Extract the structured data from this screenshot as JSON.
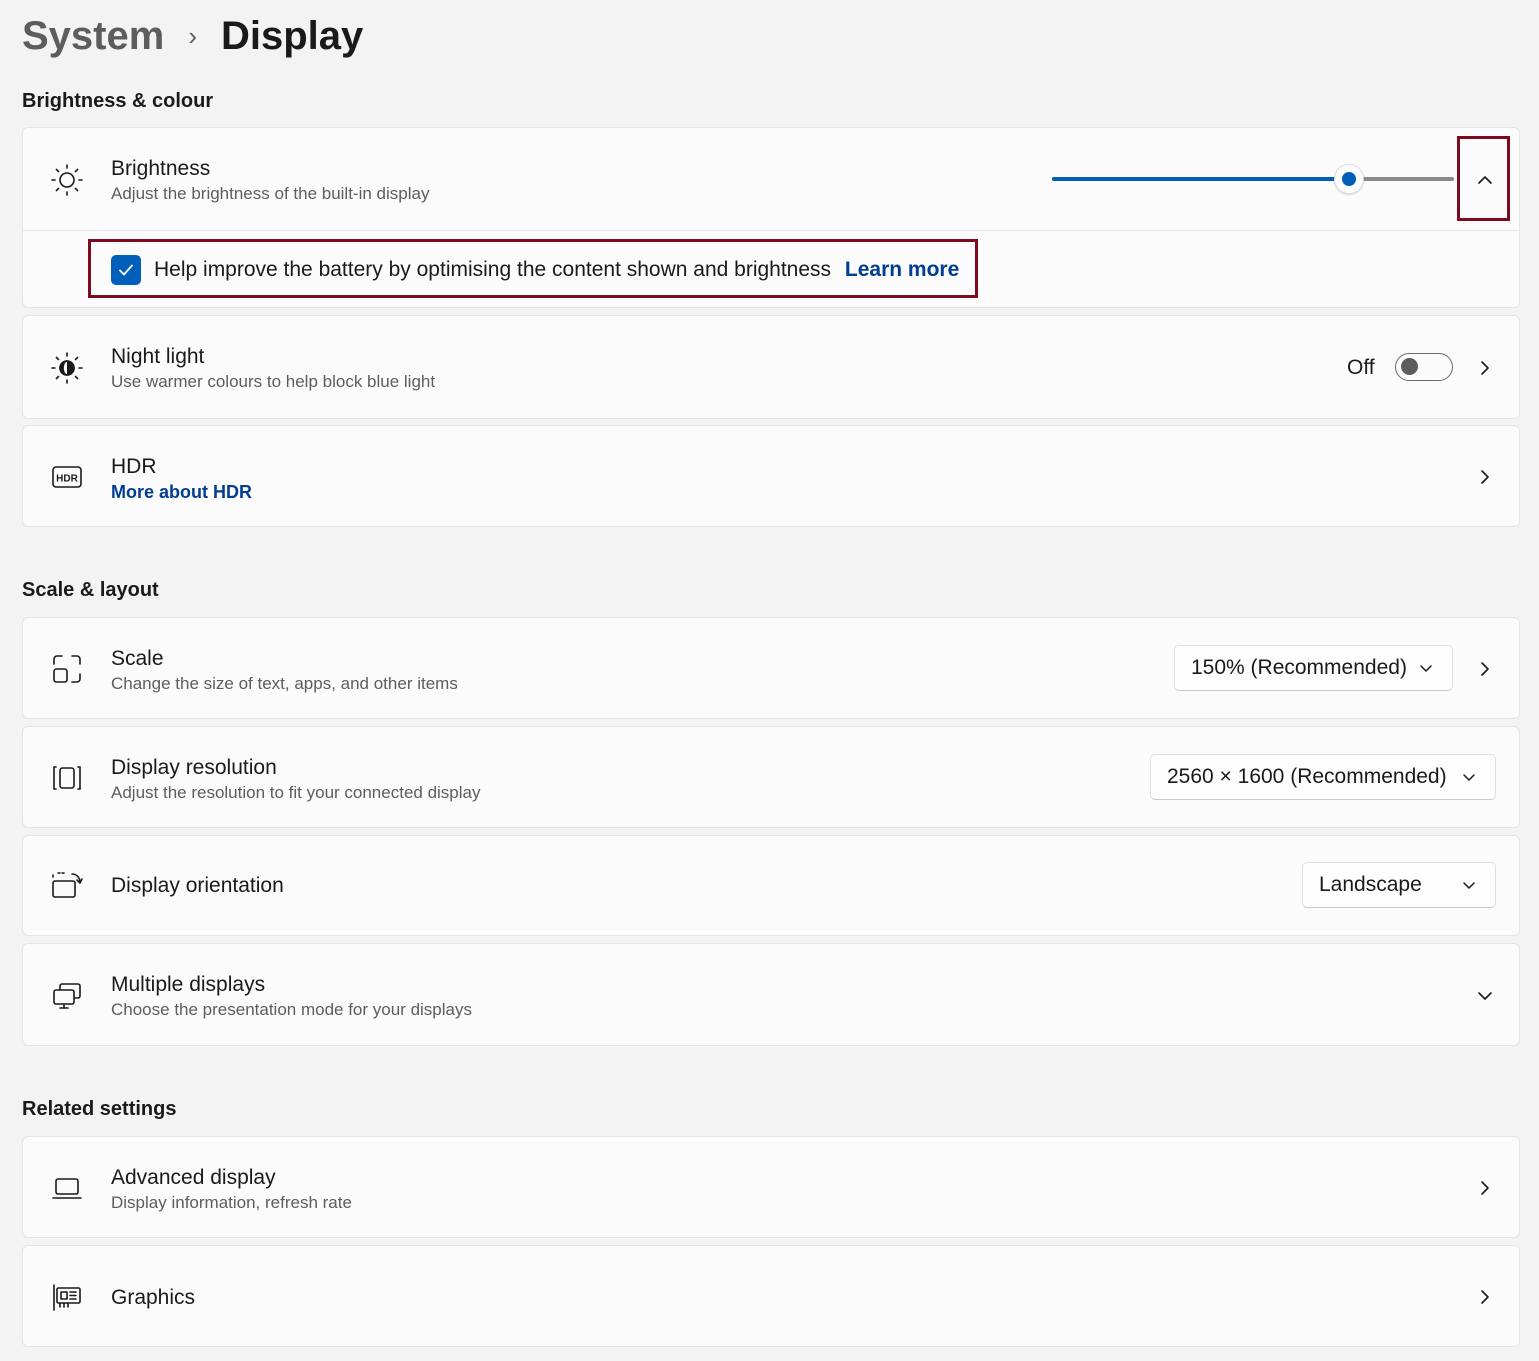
{
  "breadcrumb": {
    "parent": "System",
    "separator": "›",
    "current": "Display"
  },
  "sections": {
    "brightness_colour": "Brightness & colour",
    "scale_layout": "Scale & layout",
    "related": "Related settings"
  },
  "brightness": {
    "title": "Brightness",
    "subtitle": "Adjust the brightness of the built-in display",
    "value_fraction": 0.74,
    "battery_option": {
      "label": "Help improve the battery by optimising the content shown and brightness",
      "checked": true,
      "link": "Learn more"
    }
  },
  "night_light": {
    "title": "Night light",
    "subtitle": "Use warmer colours to help block blue light",
    "state": "Off"
  },
  "hdr": {
    "title": "HDR",
    "link": "More about HDR",
    "icon_text": "HDR"
  },
  "scale": {
    "title": "Scale",
    "subtitle": "Change the size of text, apps, and other items",
    "value": "150% (Recommended)"
  },
  "resolution": {
    "title": "Display resolution",
    "subtitle": "Adjust the resolution to fit your connected display",
    "value": "2560 × 1600 (Recommended)"
  },
  "orientation": {
    "title": "Display orientation",
    "value": "Landscape"
  },
  "multiple": {
    "title": "Multiple displays",
    "subtitle": "Choose the presentation mode for your displays"
  },
  "advanced": {
    "title": "Advanced display",
    "subtitle": "Display information, refresh rate"
  },
  "graphics": {
    "title": "Graphics"
  },
  "colors": {
    "accent": "#005fb8",
    "link": "#003e92",
    "highlight": "#7d0a1f"
  }
}
